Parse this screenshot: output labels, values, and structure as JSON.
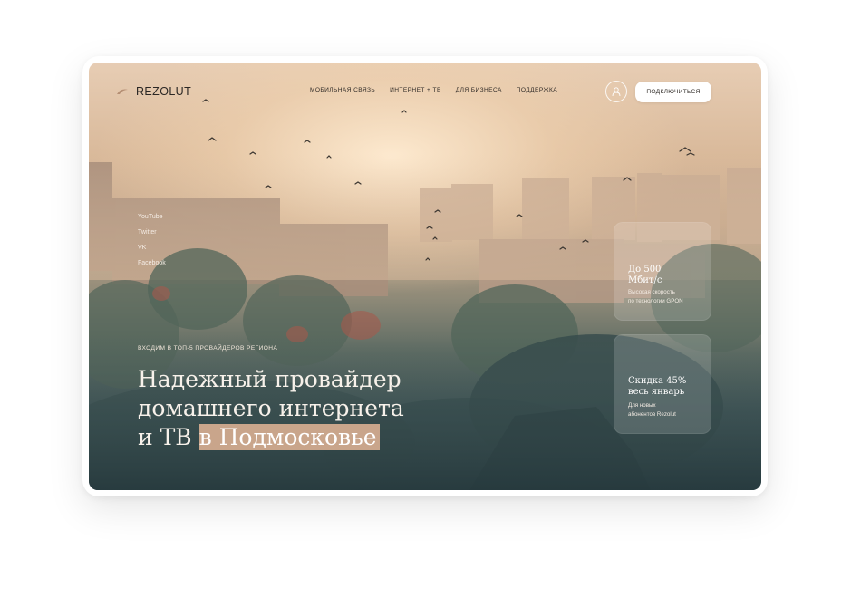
{
  "brand": {
    "name": "REZOLUT"
  },
  "nav": {
    "items": [
      {
        "label": "МОБИЛЬНАЯ СВЯЗЬ"
      },
      {
        "label": "ИНТЕРНЕТ + ТВ"
      },
      {
        "label": "ДЛЯ БИЗНЕСА"
      },
      {
        "label": "ПОДДЕРЖКА"
      }
    ]
  },
  "header": {
    "profile_icon": "user-icon",
    "connect_label": "ПОДКЛЮЧИТЬСЯ"
  },
  "social": {
    "links": [
      {
        "label": "YouTube"
      },
      {
        "label": "Twitter"
      },
      {
        "label": "VK"
      },
      {
        "label": "Facebook"
      }
    ]
  },
  "hero": {
    "tagline": "ВХОДИМ В ТОП-5 ПРОВАЙДЕРОВ РЕГИОНА",
    "headline_line1": "Надежный провайдер",
    "headline_line2": "домашнего интернета",
    "headline_line3_plain": "и ТВ",
    "headline_highlight": "в Подмосковье"
  },
  "cards": [
    {
      "title_line1": "До 500",
      "title_line2": "Мбит/с",
      "sub_line1": "Высокая скорость",
      "sub_line2": "по технологии GPON"
    },
    {
      "title_line1": "Скидка 45%",
      "title_line2": "весь январь",
      "sub_line1": "Для новых",
      "sub_line2": "абонентов Rezolut"
    }
  ],
  "colors": {
    "highlight": "#c9a58b",
    "text_dark": "#2f2a26",
    "sky_light": "#e7cdb4",
    "ground_dark": "#2f4549"
  }
}
